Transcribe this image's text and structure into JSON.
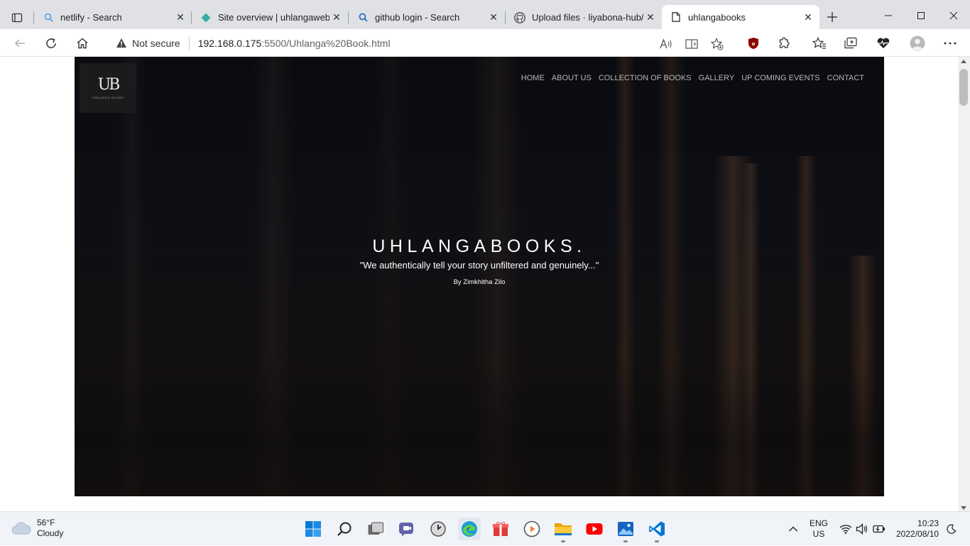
{
  "browser": {
    "tabs": [
      {
        "title": "netlify - Search",
        "icon": "search-icon"
      },
      {
        "title": "Site overview | uhlangaweb",
        "icon": "netlify-icon"
      },
      {
        "title": "github login - Search",
        "icon": "search-icon"
      },
      {
        "title": "Upload files · liyabona-hub/u",
        "icon": "github-icon"
      },
      {
        "title": "uhlangabooks",
        "icon": "page-icon",
        "active": true
      }
    ],
    "address": {
      "security_label": "Not secure",
      "host": "192.168.0.175",
      "path": ":5500/Uhlanga%20Book.html"
    }
  },
  "site": {
    "logo_monogram": "UB",
    "logo_subtitle": "UHLANGA BOOKS",
    "nav": [
      "HOME",
      "ABOUT US",
      "COLLECTION OF BOOKS",
      "GALLERY",
      "UP COMING EVENTS",
      "CONTACT"
    ],
    "hero_title": "UHLANGABOOKS.",
    "hero_quote": "\"We authentically tell your story unfiltered and genuinely...\"",
    "hero_author": "By Zimkhitha Zilo"
  },
  "taskbar": {
    "weather_temp": "56°F",
    "weather_desc": "Cloudy",
    "lang_top": "ENG",
    "lang_bottom": "US",
    "time": "10:23",
    "date": "2022/08/10"
  }
}
